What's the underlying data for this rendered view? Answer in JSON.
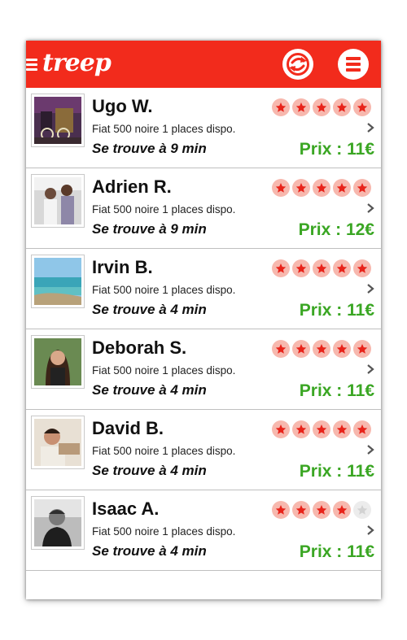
{
  "app": {
    "logo_text": "treep",
    "accent_color": "#f22b1c",
    "price_color": "#3aa623",
    "icons": {
      "hamburger": "hamburger-icon",
      "sync": "sync-arrows-icon",
      "menu": "menu-lines-icon",
      "chevron": "chevron-right-icon",
      "star": "star-icon"
    }
  },
  "drivers": [
    {
      "name": "Ugo W.",
      "car": "Fiat 500 noire 1 places dispo.",
      "eta": "Se trouve à 9 min",
      "price": "Prix : 11€",
      "rating": 5,
      "max_rating": 5
    },
    {
      "name": "Adrien R.",
      "car": "Fiat 500 noire 1 places dispo.",
      "eta": "Se trouve à 9 min",
      "price": "Prix : 12€",
      "rating": 5,
      "max_rating": 5
    },
    {
      "name": "Irvin B.",
      "car": "Fiat 500 noire 1 places dispo.",
      "eta": "Se trouve à 4 min",
      "price": "Prix : 11€",
      "rating": 5,
      "max_rating": 5
    },
    {
      "name": "Deborah S.",
      "car": "Fiat 500 noire 1 places dispo.",
      "eta": "Se trouve à 4 min",
      "price": "Prix : 11€",
      "rating": 5,
      "max_rating": 5
    },
    {
      "name": "David B.",
      "car": "Fiat 500 noire 1 places dispo.",
      "eta": "Se trouve à 4 min",
      "price": "Prix : 11€",
      "rating": 5,
      "max_rating": 5
    },
    {
      "name": "Isaac A.",
      "car": "Fiat 500 noire 1 places dispo.",
      "eta": "Se trouve à 4 min",
      "price": "Prix : 11€",
      "rating": 4,
      "max_rating": 5
    }
  ]
}
